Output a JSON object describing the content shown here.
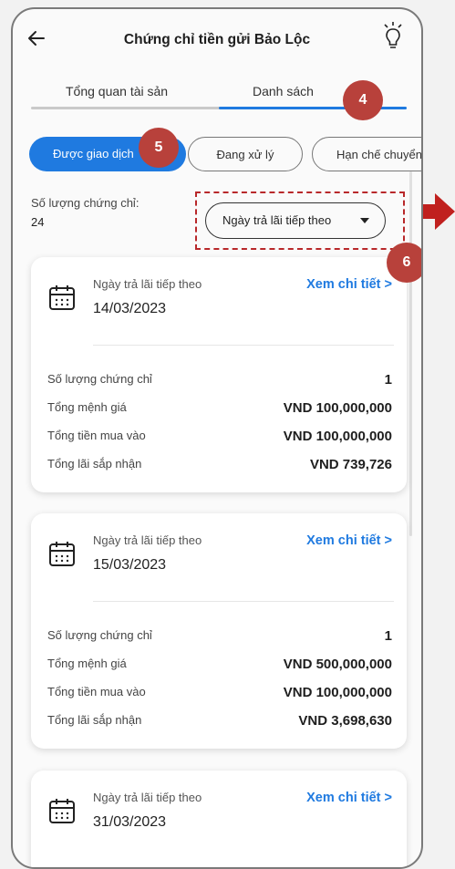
{
  "header": {
    "title": "Chứng chỉ tiền gửi Bảo Lộc",
    "back_icon": "arrow-left-icon",
    "right_icon": "lightbulb-icon"
  },
  "tabs": [
    {
      "label": "Tổng quan tài sản",
      "active": false
    },
    {
      "label": "Danh sách",
      "active": true
    }
  ],
  "filters": [
    {
      "label": "Được giao dịch",
      "active": true
    },
    {
      "label": "Đang xử lý",
      "active": false
    },
    {
      "label": "Hạn chế chuyển",
      "active": false
    }
  ],
  "summary": {
    "count_label": "Số lượng chứng chỉ:",
    "count_value": "24",
    "sort_label": "Ngày trả lãi tiếp theo"
  },
  "annotations": {
    "tabs": "4",
    "filters": "5",
    "sort": "6"
  },
  "cards": [
    {
      "next_label": "Ngày trả lãi tiếp theo",
      "date": "14/03/2023",
      "detail_link": "Xem chi tiết >",
      "rows": [
        {
          "label": "Số lượng chứng chỉ",
          "value": "1"
        },
        {
          "label": "Tổng mệnh giá",
          "value": "VND 100,000,000"
        },
        {
          "label": "Tổng tiền mua vào",
          "value": "VND 100,000,000"
        },
        {
          "label": "Tổng lãi sắp nhận",
          "value": "VND 739,726"
        }
      ]
    },
    {
      "next_label": "Ngày trả lãi tiếp theo",
      "date": "15/03/2023",
      "detail_link": "Xem chi tiết >",
      "rows": [
        {
          "label": "Số lượng chứng chỉ",
          "value": "1"
        },
        {
          "label": "Tổng mệnh giá",
          "value": "VND 500,000,000"
        },
        {
          "label": "Tổng tiền mua vào",
          "value": "VND 100,000,000"
        },
        {
          "label": "Tổng lãi sắp nhận",
          "value": "VND 3,698,630"
        }
      ]
    },
    {
      "next_label": "Ngày trả lãi tiếp theo",
      "date": "31/03/2023",
      "detail_link": "Xem chi tiết >"
    }
  ],
  "colors": {
    "accent": "#1f7ae0",
    "annotation": "#b8413b",
    "arrow": "#c0201e"
  }
}
